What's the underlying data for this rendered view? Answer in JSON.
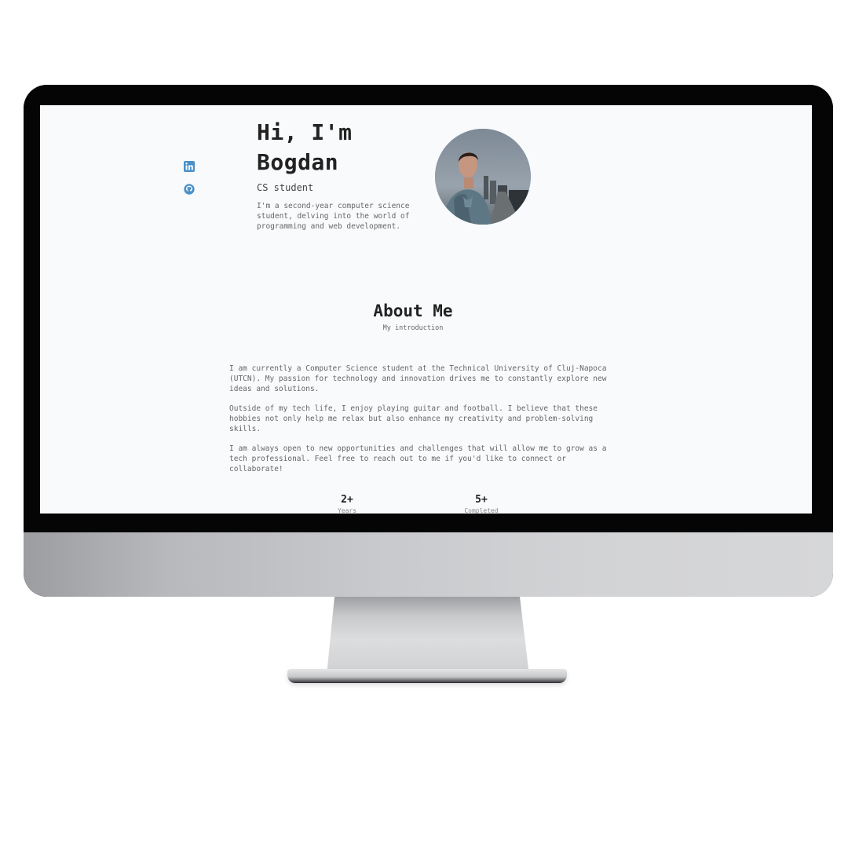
{
  "hero": {
    "title_line1": "Hi, I'm",
    "title_line2": "Bogdan",
    "subtitle": "CS student",
    "description": "I'm a second-year computer science student, delving into the world of programming and web development."
  },
  "social": {
    "icons": [
      "linkedin-icon",
      "github-icon"
    ],
    "color": "#4a90c8"
  },
  "about": {
    "title": "About Me",
    "subtitle": "My introduction",
    "paragraphs": [
      "I am currently a Computer Science student at the Technical University of Cluj-Napoca (UTCN). My passion for technology and innovation drives me to constantly explore new ideas and solutions.",
      "Outside of my tech life, I enjoy playing guitar and football. I believe that these hobbies not only help me relax but also enhance my creativity and problem-solving skills.",
      "I am always open to new opportunities and challenges that will allow me to grow as a tech professional. Feel free to reach out to me if you'd like to connect or collaborate!"
    ]
  },
  "stats": [
    {
      "value": "2+",
      "label": "Years"
    },
    {
      "value": "5+",
      "label": "Completed"
    }
  ],
  "colors": {
    "page_background": "#f8fafc",
    "heading": "#222222",
    "body_text": "#666666"
  }
}
